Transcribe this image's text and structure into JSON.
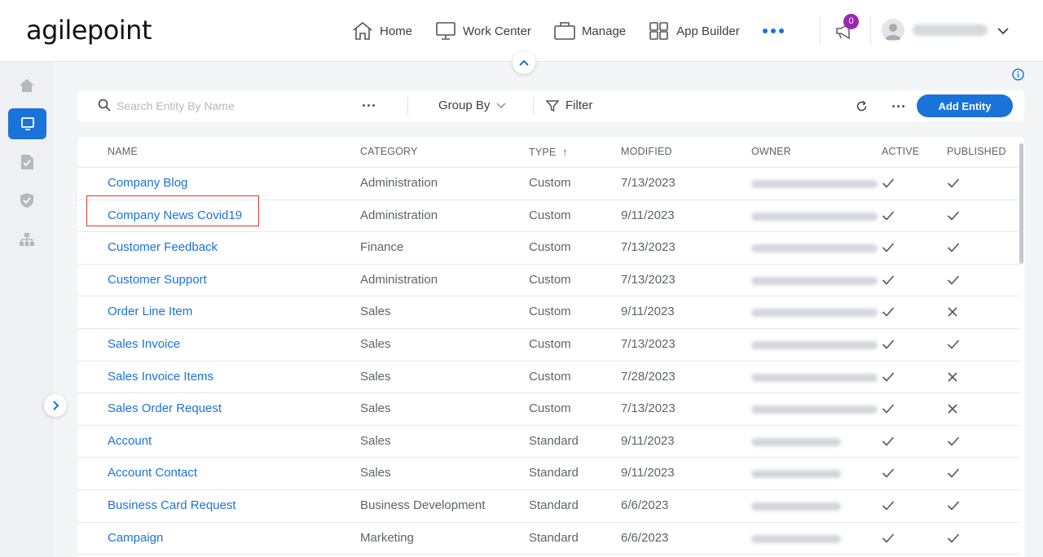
{
  "app": {
    "logo_text": "agilepoint"
  },
  "nav": {
    "items": [
      {
        "label": "Home",
        "icon": "home-icon"
      },
      {
        "label": "Work Center",
        "icon": "monitor-icon"
      },
      {
        "label": "Manage",
        "icon": "briefcase-icon"
      },
      {
        "label": "App Builder",
        "icon": "grid-icon"
      }
    ],
    "more_icon": "more-dots-icon",
    "notification_count": "0",
    "user_name": "(blurred)"
  },
  "sidebar": {
    "items": [
      {
        "name": "home",
        "icon": "home-icon",
        "active": false
      },
      {
        "name": "entities",
        "icon": "monitor-icon",
        "active": true
      },
      {
        "name": "documents",
        "icon": "document-check-icon",
        "active": false
      },
      {
        "name": "security",
        "icon": "shield-icon",
        "active": false
      },
      {
        "name": "hierarchy",
        "icon": "org-chart-icon",
        "active": false
      }
    ]
  },
  "toolbar": {
    "search_placeholder": "Search Entity By Name",
    "group_by_label": "Group By",
    "filter_label": "Filter",
    "add_button_label": "Add Entity"
  },
  "table": {
    "columns": [
      {
        "key": "name",
        "label": "NAME"
      },
      {
        "key": "category",
        "label": "CATEGORY"
      },
      {
        "key": "type",
        "label": "TYPE",
        "sort": "asc",
        "sort_glyph": "↑"
      },
      {
        "key": "modified",
        "label": "MODIFIED"
      },
      {
        "key": "owner",
        "label": "OWNER"
      },
      {
        "key": "active",
        "label": "ACTIVE"
      },
      {
        "key": "published",
        "label": "PUBLISHED"
      }
    ],
    "rows": [
      {
        "name": "Company Blog",
        "category": "Administration",
        "type": "Custom",
        "modified": "7/13/2023",
        "active": true,
        "published": true
      },
      {
        "name": "Company News Covid19",
        "category": "Administration",
        "type": "Custom",
        "modified": "9/11/2023",
        "active": true,
        "published": true,
        "highlighted": true
      },
      {
        "name": "Customer Feedback",
        "category": "Finance",
        "type": "Custom",
        "modified": "7/13/2023",
        "active": true,
        "published": true
      },
      {
        "name": "Customer Support",
        "category": "Administration",
        "type": "Custom",
        "modified": "7/13/2023",
        "active": true,
        "published": true
      },
      {
        "name": "Order Line Item",
        "category": "Sales",
        "type": "Custom",
        "modified": "9/11/2023",
        "active": true,
        "published": false
      },
      {
        "name": "Sales Invoice",
        "category": "Sales",
        "type": "Custom",
        "modified": "7/13/2023",
        "active": true,
        "published": true
      },
      {
        "name": "Sales Invoice Items",
        "category": "Sales",
        "type": "Custom",
        "modified": "7/28/2023",
        "active": true,
        "published": false
      },
      {
        "name": "Sales Order Request",
        "category": "Sales",
        "type": "Custom",
        "modified": "7/13/2023",
        "active": true,
        "published": false
      },
      {
        "name": "Account",
        "category": "Sales",
        "type": "Standard",
        "modified": "9/11/2023",
        "active": true,
        "published": true
      },
      {
        "name": "Account Contact",
        "category": "Sales",
        "type": "Standard",
        "modified": "9/11/2023",
        "active": true,
        "published": true
      },
      {
        "name": "Business Card Request",
        "category": "Business Development",
        "type": "Standard",
        "modified": "6/6/2023",
        "active": true,
        "published": true
      },
      {
        "name": "Campaign",
        "category": "Marketing",
        "type": "Standard",
        "modified": "6/6/2023",
        "active": true,
        "published": true
      }
    ]
  },
  "colors": {
    "accent": "#1a73d9",
    "badge": "#9c27b0",
    "highlight_border": "#d9362b"
  }
}
